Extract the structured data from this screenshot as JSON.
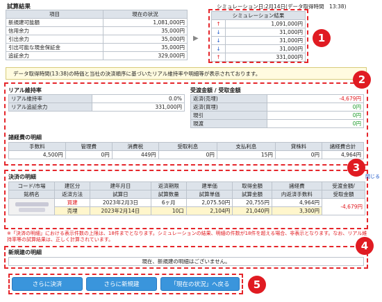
{
  "header": {
    "title": "試算結果",
    "sim_caption": "シミュレーション日:2月14日(データ取得時間　13:38)"
  },
  "summary": {
    "col_item": "項目",
    "col_current": "現在の状況",
    "col_sim": "シミュレーション結果",
    "rows": [
      {
        "label": "新規建可能額",
        "current": "1,081,000円",
        "arrow": "↑",
        "sim": "1,091,000円"
      },
      {
        "label": "信用余力",
        "current": "35,000円",
        "arrow": "↓",
        "sim": "31,000円"
      },
      {
        "label": "引出余力",
        "current": "35,000円",
        "arrow": "↓",
        "sim": "31,000円"
      },
      {
        "label": "引出可能な現金保証金",
        "current": "35,000円",
        "arrow": "↓",
        "sim": "31,000円"
      },
      {
        "label": "追証余力",
        "current": "329,000円",
        "arrow": "↑",
        "sim": "331,000円"
      }
    ]
  },
  "notice": "データ取得時間(13:38)の時価と当社の決済順序に基づいたリアル維持率や明細等が表示されております。",
  "real": {
    "title": "リアル維持率",
    "rows": [
      {
        "label": "リアル維持率",
        "value": "0.0%"
      },
      {
        "label": "リアル追証余力",
        "value": "331,000円"
      }
    ]
  },
  "transfer": {
    "title": "受渡金額 / 受取金額",
    "rows": [
      {
        "label": "返済(売埋)",
        "value": "-4,679円"
      },
      {
        "label": "返済(買埋)",
        "value": "0円"
      },
      {
        "label": "現引",
        "value": "0円"
      },
      {
        "label": "現渡",
        "value": "0円"
      }
    ]
  },
  "fees": {
    "title": "諸経費の明細",
    "headers": [
      "手数料",
      "管理費",
      "消費税",
      "受取利息",
      "支払利息",
      "貸株料",
      "諸経費合計"
    ],
    "values": [
      "4,500円",
      "0円",
      "449円",
      "0円",
      "15円",
      "0円",
      "4,964円"
    ]
  },
  "settle": {
    "title": "決済の明細",
    "help": "閉じる",
    "h1": [
      "コード/市場",
      "建区分",
      "建年月日",
      "返済期限",
      "建単価",
      "取得金額",
      "諸経費",
      "受渡金額/"
    ],
    "h2": [
      "銘柄名",
      "返済方法",
      "試算日",
      "試算数量",
      "試算単価",
      "試算金額",
      "内返済手数料",
      "受取金額"
    ],
    "r1": [
      "買建",
      "2023年2月3日",
      "6ヶ月",
      "2,075.50円",
      "20,755円",
      "4,964円"
    ],
    "r2": [
      "売埋",
      "2023年2月14日",
      "10口",
      "2,104円",
      "21,040円",
      "3,300円"
    ],
    "total": "-4,679円"
  },
  "warning": "※「決済の明細」における表示件数の上限は、18件までとなります。シミュレーションの結果、明細の件数が18件を超える場合、非表示となります。なお、リアル維持率等の試算結果は、正しく計算されています。",
  "newpos": {
    "title": "新規建の明細",
    "message": "現在、新規建の明細はございません。"
  },
  "buttons": [
    "さらに決済",
    "さらに新規建",
    "「現在の状況」へ戻る"
  ],
  "markers": [
    "1",
    "2",
    "3",
    "4",
    "5"
  ]
}
